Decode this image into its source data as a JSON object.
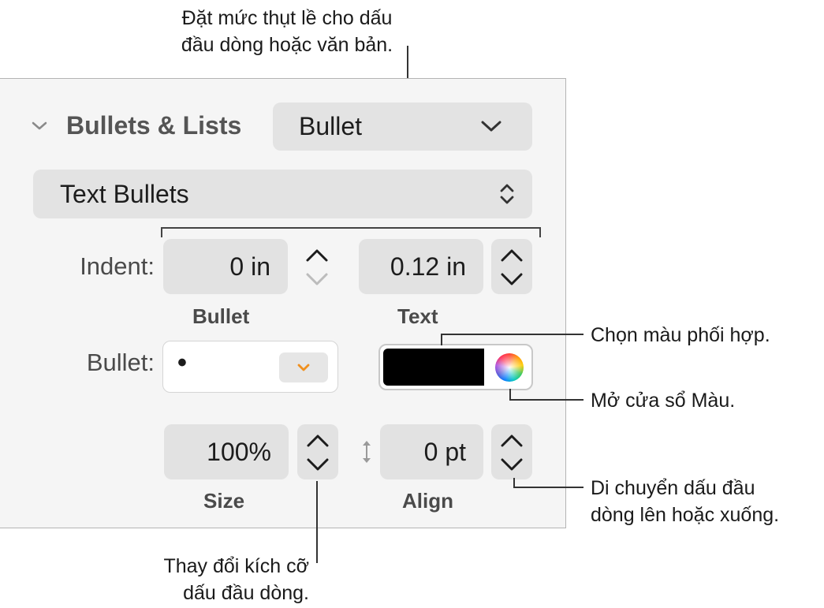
{
  "callouts": {
    "indent_line1": "Đặt mức thụt lề cho dấu",
    "indent_line2": "đầu dòng hoặc văn bản.",
    "color": "Chọn màu phối hợp.",
    "color_window": "Mở cửa sổ Màu.",
    "align_line1": "Di chuyển dấu đầu",
    "align_line2": "dòng lên hoặc xuống.",
    "size_line1": "Thay đổi kích cỡ",
    "size_line2": "dấu đầu dòng."
  },
  "section": {
    "title": "Bullets & Lists",
    "toggle_icon": "chevron-down-icon",
    "list_style": "Bullet",
    "bullet_type": "Text Bullets"
  },
  "indent": {
    "label": "Indent:",
    "bullet_value": "0 in",
    "bullet_sublabel": "Bullet",
    "text_value": "0.12 in",
    "text_sublabel": "Text"
  },
  "bullet": {
    "label": "Bullet:",
    "character": "•",
    "popup_icon": "chevron-down-icon",
    "color": "#000000",
    "color_wheel_icon": "color-wheel-icon"
  },
  "size": {
    "value": "100%",
    "sublabel": "Size"
  },
  "align": {
    "value": "0 pt",
    "sublabel": "Align",
    "icon": "vertical-arrows-icon"
  },
  "colors": {
    "accent_orange": "#f0901e",
    "panel_bg": "#f5f5f5"
  }
}
